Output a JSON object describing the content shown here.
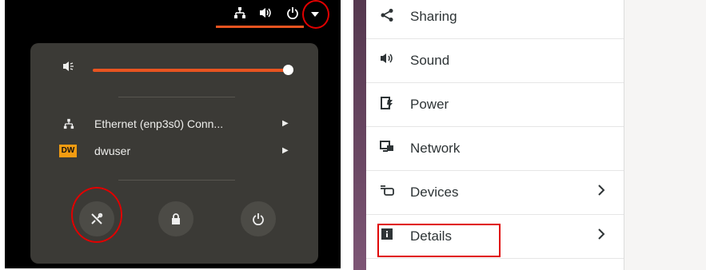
{
  "top_bar": {
    "icons": [
      "network-wired-icon",
      "volume-icon",
      "power-icon",
      "menu-arrow-icon"
    ]
  },
  "system_menu": {
    "volume_level": 0.98,
    "items": [
      {
        "icon": "network-wired-icon",
        "label": "Ethernet (enp3s0) Conn...",
        "submenu": true
      },
      {
        "icon": "user-logo-icon",
        "logo_text": "DW",
        "label": "dwuser",
        "submenu": true
      }
    ],
    "buttons": [
      "settings-button",
      "lock-button",
      "power-off-button"
    ]
  },
  "settings_sidebar": {
    "items": [
      {
        "icon": "share-icon",
        "label": "Sharing",
        "chevron": false
      },
      {
        "icon": "sound-icon",
        "label": "Sound",
        "chevron": false
      },
      {
        "icon": "power-icon",
        "label": "Power",
        "chevron": false
      },
      {
        "icon": "network-icon",
        "label": "Network",
        "chevron": false
      },
      {
        "icon": "devices-icon",
        "label": "Devices",
        "chevron": true
      },
      {
        "icon": "details-icon",
        "label": "Details",
        "chevron": true
      }
    ]
  },
  "colors": {
    "accent": "#e95420",
    "highlight": "#e00000",
    "popup_bg": "#3b3a36"
  }
}
